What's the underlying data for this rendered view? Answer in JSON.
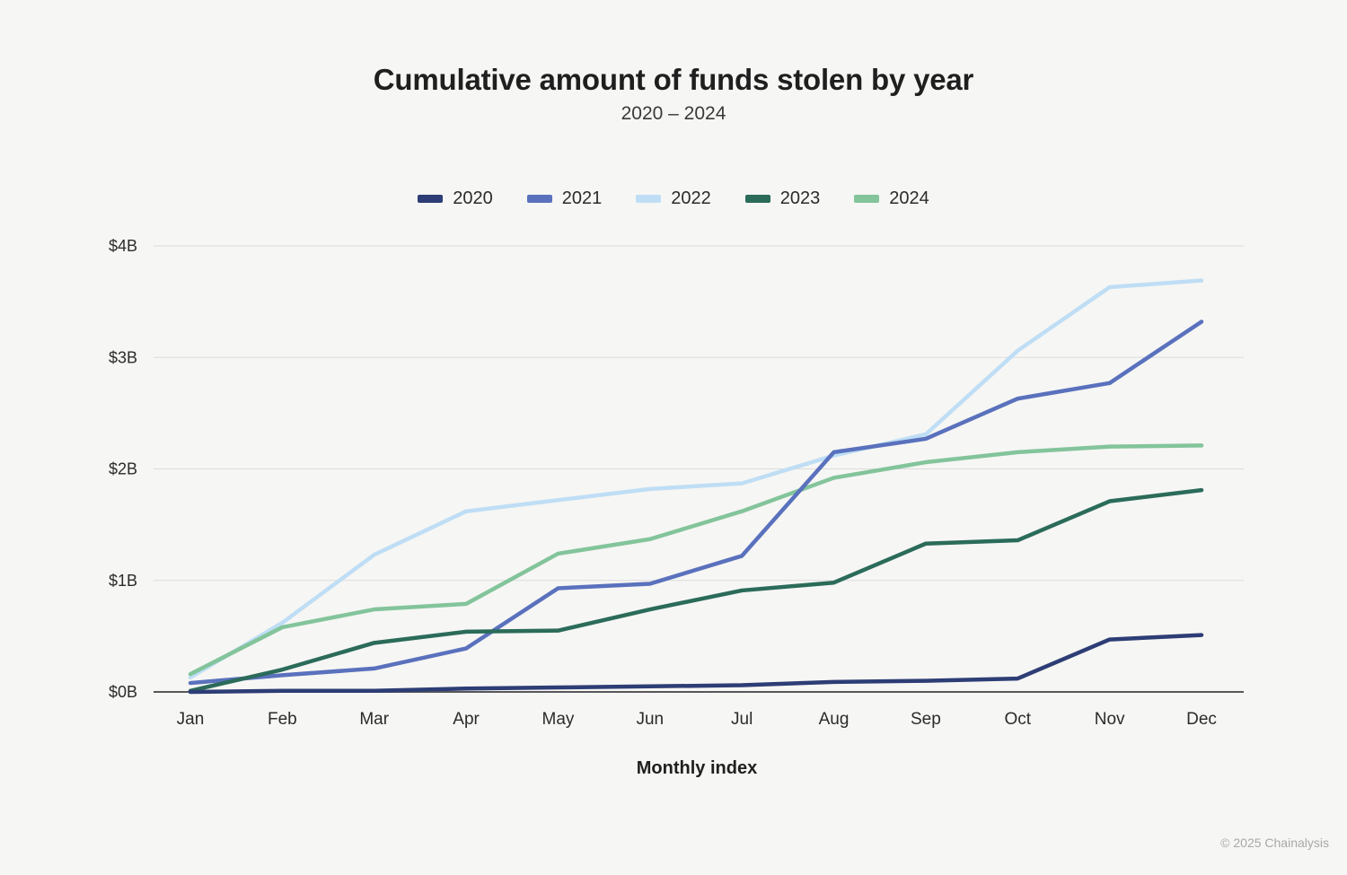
{
  "header": {
    "title": "Cumulative amount of funds stolen by year",
    "subtitle": "2020 – 2024"
  },
  "axis": {
    "x_title": "Monthly index"
  },
  "footer": {
    "credit": "© 2025 Chainalysis"
  },
  "legend": [
    {
      "label": "2020",
      "color": "#2d3d75"
    },
    {
      "label": "2021",
      "color": "#5a71bd"
    },
    {
      "label": "2022",
      "color": "#bfdef5"
    },
    {
      "label": "2023",
      "color": "#2b6b5a"
    },
    {
      "label": "2024",
      "color": "#83c49b"
    }
  ],
  "chart_data": {
    "type": "line",
    "title": "Cumulative amount of funds stolen by year",
    "subtitle": "2020 – 2024",
    "xlabel": "Monthly index",
    "ylabel": "",
    "categories": [
      "Jan",
      "Feb",
      "Mar",
      "Apr",
      "May",
      "Jun",
      "Jul",
      "Aug",
      "Sep",
      "Oct",
      "Nov",
      "Dec"
    ],
    "ytick_labels": [
      "$0B",
      "$1B",
      "$2B",
      "$3B",
      "$4B"
    ],
    "ytick_values": [
      0,
      1,
      2,
      3,
      4
    ],
    "ylim": [
      0,
      4
    ],
    "grid": true,
    "legend_position": "top-center",
    "units": "billions of USD",
    "series": [
      {
        "name": "2020",
        "color": "#2d3d75",
        "values": [
          0.0,
          0.01,
          0.01,
          0.03,
          0.04,
          0.05,
          0.06,
          0.09,
          0.1,
          0.12,
          0.47,
          0.51
        ]
      },
      {
        "name": "2021",
        "color": "#5a71bd",
        "values": [
          0.08,
          0.15,
          0.21,
          0.39,
          0.93,
          0.97,
          1.22,
          2.15,
          2.27,
          2.63,
          2.77,
          3.32
        ]
      },
      {
        "name": "2022",
        "color": "#bfdef5",
        "values": [
          0.13,
          0.62,
          1.23,
          1.62,
          1.72,
          1.82,
          1.87,
          2.12,
          2.31,
          3.06,
          3.63,
          3.69
        ]
      },
      {
        "name": "2023",
        "color": "#2b6b5a",
        "values": [
          0.01,
          0.2,
          0.44,
          0.54,
          0.55,
          0.74,
          0.91,
          0.98,
          1.33,
          1.36,
          1.71,
          1.81
        ]
      },
      {
        "name": "2024",
        "color": "#83c49b",
        "values": [
          0.16,
          0.58,
          0.74,
          0.79,
          1.24,
          1.37,
          1.62,
          1.92,
          2.06,
          2.15,
          2.2,
          2.21
        ]
      }
    ]
  }
}
